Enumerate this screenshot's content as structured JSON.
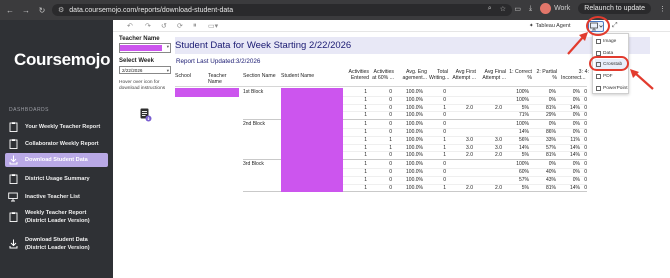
{
  "browser": {
    "url": "data.coursemojo.com/reports/download-student-data",
    "profile_label": "Work",
    "relaunch_label": "Relaunch to update"
  },
  "sidebar": {
    "logo": "Coursemojo",
    "section_label": "DASHBOARDS",
    "items": [
      {
        "label": "Your Weekly Teacher Report",
        "icon": "clipboard-icon"
      },
      {
        "label": "Collaborator Weekly Report",
        "icon": "clipboard-icon"
      },
      {
        "label": "Download Student Data",
        "icon": "download-icon"
      },
      {
        "label": "District Usage Summary",
        "icon": "clipboard-icon"
      },
      {
        "label": "Inactive Teacher List",
        "icon": "presentation-icon"
      },
      {
        "label_1": "Weekly Teacher Report",
        "label_2": "(District Leader Version)",
        "icon": "clipboard-icon"
      },
      {
        "label_1": "Download Student Data",
        "label_2": "(District Leader Version)",
        "icon": "download-icon"
      }
    ]
  },
  "toolbar": {
    "tableau_agent": "Tableau Agent"
  },
  "filters": {
    "teacher_label": "Teacher Name",
    "week_label": "Select Week",
    "week_value": "2/22/2026",
    "hover_note": "Hover over icon for download instructions"
  },
  "report": {
    "title": "Student Data for Week Starting 2/22/2026",
    "updated": "Report Last Updated:3/2/2026"
  },
  "table": {
    "headers": [
      "School",
      "Teacher Name",
      "Section Name",
      "Student Name",
      "Activities Entered",
      "Activities at 60% ...",
      "Avg. Eng agement...",
      "Total Writing...",
      "Avg First Attempt ...",
      "Avg Final Attempt ...",
      "1: Correct %",
      "2: Partial %",
      "3: Incorrect...",
      "4:"
    ],
    "groups": [
      {
        "section": "1st Block",
        "rows": [
          [
            "1",
            "0",
            "100.0%",
            "0",
            "",
            "",
            "100%",
            "0%",
            "0%",
            "0"
          ],
          [
            "1",
            "0",
            "100.0%",
            "0",
            "",
            "",
            "100%",
            "0%",
            "0%",
            "0"
          ],
          [
            "1",
            "0",
            "100.0%",
            "1",
            "2.0",
            "2.0",
            "5%",
            "81%",
            "14%",
            "0"
          ],
          [
            "1",
            "0",
            "100.0%",
            "0",
            "",
            "",
            "71%",
            "29%",
            "0%",
            "0"
          ]
        ]
      },
      {
        "section": "2nd Block",
        "rows": [
          [
            "1",
            "0",
            "100.0%",
            "0",
            "",
            "",
            "100%",
            "0%",
            "0%",
            "0"
          ],
          [
            "1",
            "0",
            "100.0%",
            "0",
            "",
            "",
            "14%",
            "86%",
            "0%",
            "0"
          ],
          [
            "1",
            "1",
            "100.0%",
            "1",
            "3.0",
            "3.0",
            "56%",
            "33%",
            "11%",
            "0"
          ],
          [
            "1",
            "1",
            "100.0%",
            "1",
            "3.0",
            "3.0",
            "14%",
            "57%",
            "14%",
            "0"
          ],
          [
            "1",
            "0",
            "100.0%",
            "1",
            "2.0",
            "2.0",
            "5%",
            "81%",
            "14%",
            "0"
          ]
        ]
      },
      {
        "section": "3rd Block",
        "rows": [
          [
            "1",
            "0",
            "100.0%",
            "0",
            "",
            "",
            "100%",
            "0%",
            "0%",
            "0"
          ],
          [
            "1",
            "0",
            "100.0%",
            "0",
            "",
            "",
            "60%",
            "40%",
            "0%",
            "0"
          ],
          [
            "1",
            "0",
            "100.0%",
            "0",
            "",
            "",
            "57%",
            "43%",
            "0%",
            "0"
          ],
          [
            "1",
            "0",
            "100.0%",
            "1",
            "2.0",
            "2.0",
            "5%",
            "81%",
            "14%",
            "0"
          ]
        ]
      }
    ]
  },
  "download_menu": {
    "items": [
      "Image",
      "Data",
      "Crosstab",
      "PDF",
      "PowerPoint"
    ],
    "highlighted": "Crosstab"
  },
  "colors": {
    "sidebar_bg": "#2f3135",
    "active_item": "#b9a9e6",
    "redaction": "#cc55ee",
    "title_band": "#e8e8f6",
    "title_text": "#1a1a72",
    "annotation_red": "#e23b2e"
  }
}
